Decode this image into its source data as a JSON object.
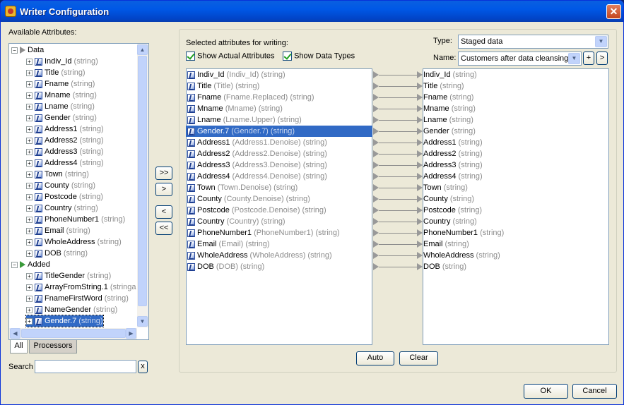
{
  "window": {
    "title": "Writer Configuration",
    "close_glyph": "✕"
  },
  "left": {
    "available_label": "Available Attributes:",
    "tree": [
      {
        "kind": "folder",
        "label": "Data",
        "type": "",
        "depth": 0,
        "selected": false,
        "green": false
      },
      {
        "kind": "attr",
        "label": "Indiv_Id",
        "type": "(string)",
        "depth": 1,
        "selected": false
      },
      {
        "kind": "attr",
        "label": "Title",
        "type": "(string)",
        "depth": 1,
        "selected": false
      },
      {
        "kind": "attr",
        "label": "Fname",
        "type": "(string)",
        "depth": 1,
        "selected": false
      },
      {
        "kind": "attr",
        "label": "Mname",
        "type": "(string)",
        "depth": 1,
        "selected": false
      },
      {
        "kind": "attr",
        "label": "Lname",
        "type": "(string)",
        "depth": 1,
        "selected": false
      },
      {
        "kind": "attr",
        "label": "Gender",
        "type": "(string)",
        "depth": 1,
        "selected": false
      },
      {
        "kind": "attr",
        "label": "Address1",
        "type": "(string)",
        "depth": 1,
        "selected": false
      },
      {
        "kind": "attr",
        "label": "Address2",
        "type": "(string)",
        "depth": 1,
        "selected": false
      },
      {
        "kind": "attr",
        "label": "Address3",
        "type": "(string)",
        "depth": 1,
        "selected": false
      },
      {
        "kind": "attr",
        "label": "Address4",
        "type": "(string)",
        "depth": 1,
        "selected": false
      },
      {
        "kind": "attr",
        "label": "Town",
        "type": "(string)",
        "depth": 1,
        "selected": false
      },
      {
        "kind": "attr",
        "label": "County",
        "type": "(string)",
        "depth": 1,
        "selected": false
      },
      {
        "kind": "attr",
        "label": "Postcode",
        "type": "(string)",
        "depth": 1,
        "selected": false
      },
      {
        "kind": "attr",
        "label": "Country",
        "type": "(string)",
        "depth": 1,
        "selected": false
      },
      {
        "kind": "attr",
        "label": "PhoneNumber1",
        "type": "(string)",
        "depth": 1,
        "selected": false
      },
      {
        "kind": "attr",
        "label": "Email",
        "type": "(string)",
        "depth": 1,
        "selected": false
      },
      {
        "kind": "attr",
        "label": "WholeAddress",
        "type": "(string)",
        "depth": 1,
        "selected": false
      },
      {
        "kind": "attr",
        "label": "DOB",
        "type": "(string)",
        "depth": 1,
        "selected": false
      },
      {
        "kind": "folder",
        "label": "Added",
        "type": "",
        "depth": 0,
        "selected": false,
        "green": true
      },
      {
        "kind": "attr",
        "label": "TitleGender",
        "type": "(string)",
        "depth": 1,
        "selected": false
      },
      {
        "kind": "attr",
        "label": "ArrayFromString.1",
        "type": "(stringa",
        "depth": 1,
        "selected": false
      },
      {
        "kind": "attr",
        "label": "FnameFirstWord",
        "type": "(string)",
        "depth": 1,
        "selected": false
      },
      {
        "kind": "attr",
        "label": "NameGender",
        "type": "(string)",
        "depth": 1,
        "selected": false
      },
      {
        "kind": "attr",
        "label": "Gender.7",
        "type": "(string)",
        "depth": 1,
        "selected": true
      }
    ],
    "tabs": [
      "All",
      "Processors"
    ],
    "active_tab": 0,
    "search_label": "Search",
    "search_value": "",
    "search_clear": "x"
  },
  "transfer": {
    "add_all": ">>",
    "add": ">",
    "remove": "<",
    "remove_all": "<<"
  },
  "right": {
    "selected_label": "Selected attributes for writing:",
    "show_actual": "Show Actual Attributes",
    "show_actual_checked": true,
    "show_types": "Show Data Types",
    "show_types_checked": true,
    "type_label": "Type:",
    "type_value": "Staged data",
    "name_label": "Name:",
    "name_value": "Customers after data cleansing",
    "plus": "+",
    "next": ">",
    "mappings": [
      {
        "name": "Indiv_Id",
        "source": "(Indiv_Id)",
        "type": "(string)",
        "target": "Indiv_Id",
        "target_type": "(string)",
        "selected": false
      },
      {
        "name": "Title",
        "source": "(Title)",
        "type": "(string)",
        "target": "Title",
        "target_type": "(string)",
        "selected": false
      },
      {
        "name": "Fname",
        "source": "(Fname.Replaced)",
        "type": "(string)",
        "target": "Fname",
        "target_type": "(string)",
        "selected": false
      },
      {
        "name": "Mname",
        "source": "(Mname)",
        "type": "(string)",
        "target": "Mname",
        "target_type": "(string)",
        "selected": false
      },
      {
        "name": "Lname",
        "source": "(Lname.Upper)",
        "type": "(string)",
        "target": "Lname",
        "target_type": "(string)",
        "selected": false
      },
      {
        "name": "Gender.7",
        "source": "(Gender.7)",
        "type": "(string)",
        "target": "Gender",
        "target_type": "(string)",
        "selected": true
      },
      {
        "name": "Address1",
        "source": "(Address1.Denoise)",
        "type": "(string)",
        "target": "Address1",
        "target_type": "(string)",
        "selected": false
      },
      {
        "name": "Address2",
        "source": "(Address2.Denoise)",
        "type": "(string)",
        "target": "Address2",
        "target_type": "(string)",
        "selected": false
      },
      {
        "name": "Address3",
        "source": "(Address3.Denoise)",
        "type": "(string)",
        "target": "Address3",
        "target_type": "(string)",
        "selected": false
      },
      {
        "name": "Address4",
        "source": "(Address4.Denoise)",
        "type": "(string)",
        "target": "Address4",
        "target_type": "(string)",
        "selected": false
      },
      {
        "name": "Town",
        "source": "(Town.Denoise)",
        "type": "(string)",
        "target": "Town",
        "target_type": "(string)",
        "selected": false
      },
      {
        "name": "County",
        "source": "(County.Denoise)",
        "type": "(string)",
        "target": "County",
        "target_type": "(string)",
        "selected": false
      },
      {
        "name": "Postcode",
        "source": "(Postcode.Denoise)",
        "type": "(string)",
        "target": "Postcode",
        "target_type": "(string)",
        "selected": false
      },
      {
        "name": "Country",
        "source": "(Country)",
        "type": "(string)",
        "target": "Country",
        "target_type": "(string)",
        "selected": false
      },
      {
        "name": "PhoneNumber1",
        "source": "(PhoneNumber1)",
        "type": "(string)",
        "target": "PhoneNumber1",
        "target_type": "(string)",
        "selected": false
      },
      {
        "name": "Email",
        "source": "(Email)",
        "type": "(string)",
        "target": "Email",
        "target_type": "(string)",
        "selected": false
      },
      {
        "name": "WholeAddress",
        "source": "(WholeAddress)",
        "type": "(string)",
        "target": "WholeAddress",
        "target_type": "(string)",
        "selected": false
      },
      {
        "name": "DOB",
        "source": "(DOB)",
        "type": "(string)",
        "target": "DOB",
        "target_type": "(string)",
        "selected": false
      }
    ],
    "auto_button": "Auto",
    "clear_button": "Clear"
  },
  "footer": {
    "ok": "OK",
    "cancel": "Cancel"
  },
  "colors": {
    "selection": "#316ac5",
    "titlebar": "#0058e6",
    "dialog_bg": "#ece9d8"
  }
}
